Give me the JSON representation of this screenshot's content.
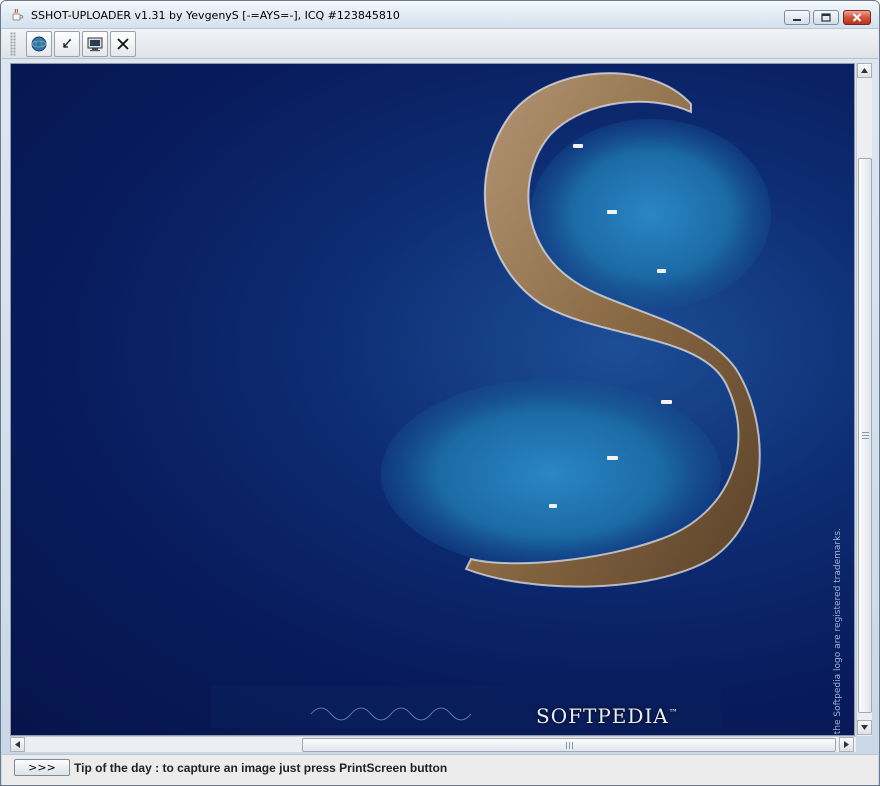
{
  "window": {
    "title": "SSHOT-UPLOADER v1.31 by YevgenyS [-=AYS=-], ICQ #123845810",
    "icon": "java-cup-icon"
  },
  "title_buttons": {
    "minimize": "minimize-icon",
    "maximize": "maximize-icon",
    "close": "close-icon"
  },
  "toolbar": {
    "buttons": [
      {
        "name": "upload-web-button",
        "icon": "globe-icon"
      },
      {
        "name": "restore-button",
        "icon": "arrow-icon"
      },
      {
        "name": "capture-screen-button",
        "icon": "monitor-icon"
      },
      {
        "name": "close-image-button",
        "icon": "x-icon"
      }
    ]
  },
  "viewport": {
    "image_wordmark": "SOFTPEDIA",
    "image_trademark": "™",
    "trademark_notice": "and the Softpedia logo are registered trademarks."
  },
  "statusbar": {
    "next_tip_label": ">>>",
    "tip_text": "Tip of the day : to capture an image just press PrintScreen button"
  },
  "colors": {
    "ocean_deep": "#081b5c",
    "ocean_light": "#1c4e96",
    "island_rock": "#8a6a45",
    "close_button": "#c8412a"
  }
}
